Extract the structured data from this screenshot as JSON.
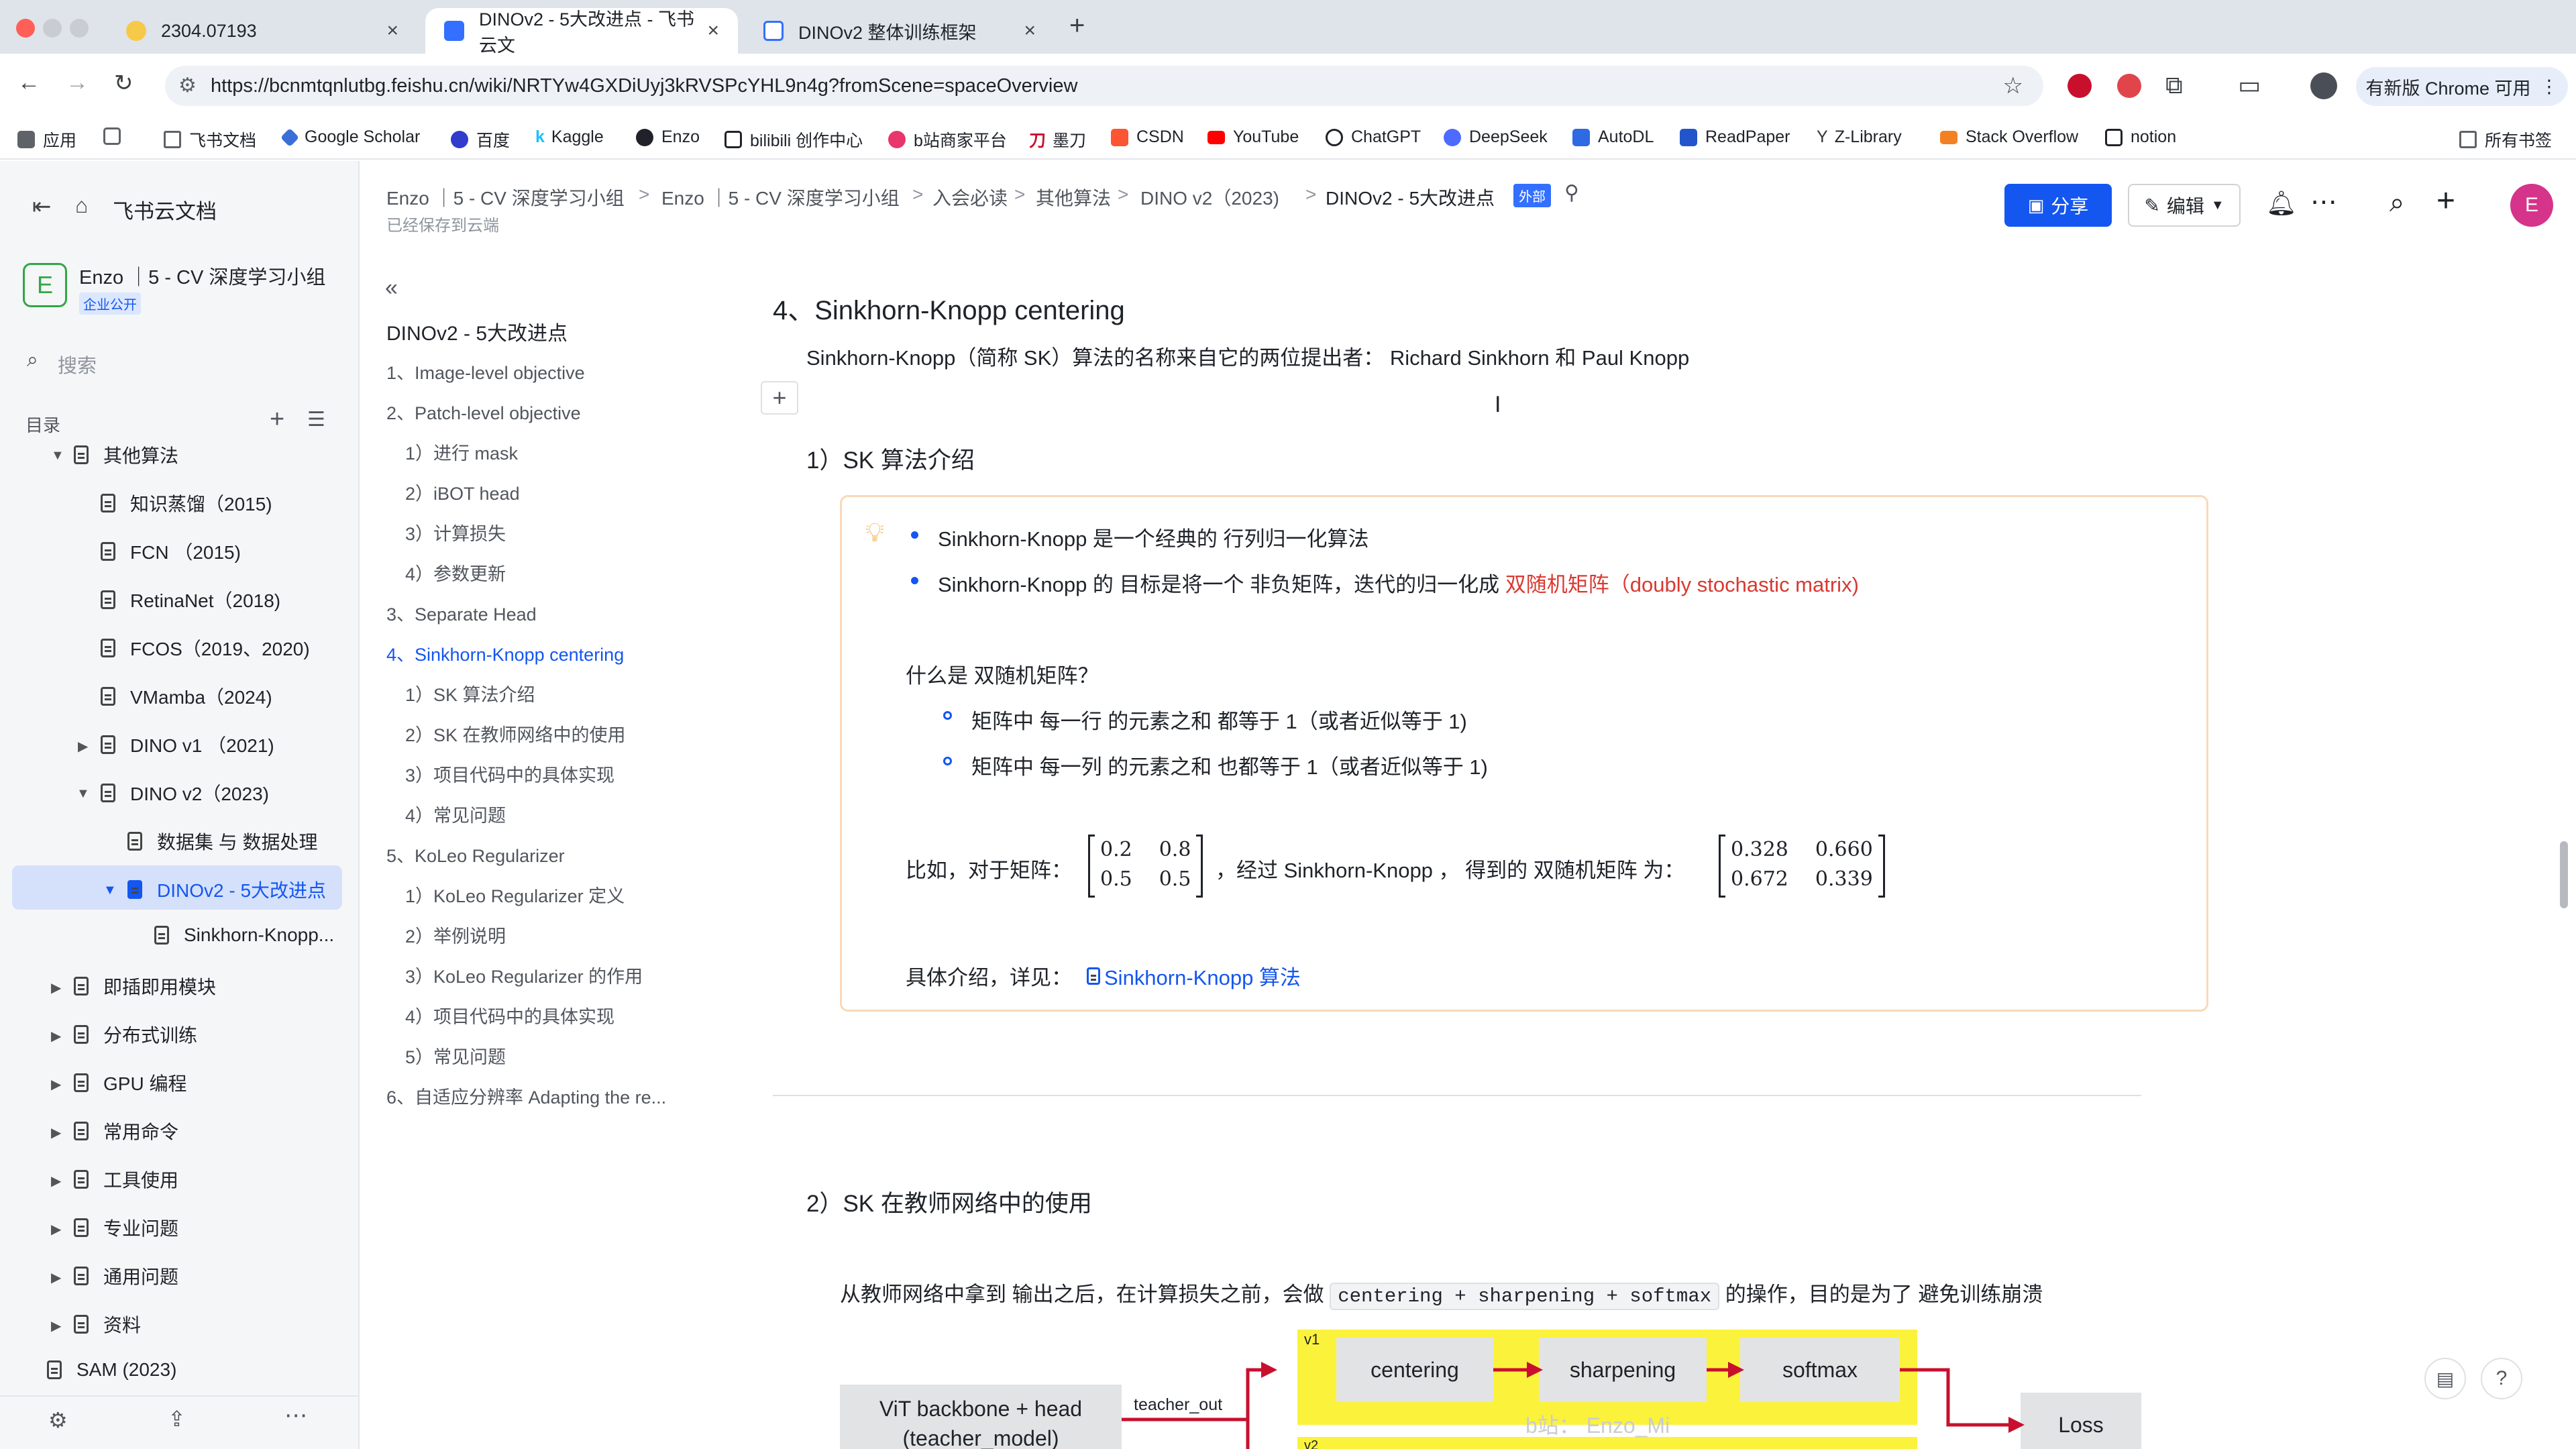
{
  "browser": {
    "tabs": [
      {
        "title": "2304.07193"
      },
      {
        "title": "DINOv2 - 5大改进点 - 飞书云文"
      },
      {
        "title": "DINOv2 整体训练框架"
      }
    ],
    "new_tab": "+",
    "url": "https://bcnmtqnlutbg.feishu.cn/wiki/NRTYw4GXDiUyj3kRVSPcYHL9n4g?fromScene=spaceOverview",
    "update_button": "有新版 Chrome 可用",
    "bookmarks": [
      "应用",
      "飞书文档",
      "Google Scholar",
      "百度",
      "Kaggle",
      "Enzo",
      "bilibili 创作中心",
      "b站商家平台",
      "墨刀",
      "CSDN",
      "YouTube",
      "ChatGPT",
      "DeepSeek",
      "AutoDL",
      "ReadPaper",
      "Z-Library",
      "Stack Overflow",
      "notion"
    ],
    "all_bookmarks": "所有书签"
  },
  "sidebar": {
    "app_title": "飞书云文档",
    "space_avatar": "E",
    "space_name": "Enzo ｜5 - CV 深度学习小组",
    "space_badge": "企业公开",
    "search_placeholder": "搜索",
    "toc_label": "目录",
    "items": [
      {
        "label": "其他算法"
      },
      {
        "label": "知识蒸馏（2015)"
      },
      {
        "label": "FCN （2015)"
      },
      {
        "label": "RetinaNet（2018)"
      },
      {
        "label": "FCOS（2019、2020)"
      },
      {
        "label": "VMamba（2024)"
      },
      {
        "label": "DINO v1 （2021)"
      },
      {
        "label": "DINO v2（2023)"
      },
      {
        "label": "数据集 与 数据处理"
      },
      {
        "label": "DINOv2 - 5大改进点"
      },
      {
        "label": "Sinkhorn-Knopp..."
      },
      {
        "label": "即插即用模块"
      },
      {
        "label": "分布式训练"
      },
      {
        "label": "GPU 编程"
      },
      {
        "label": "常用命令"
      },
      {
        "label": "工具使用"
      },
      {
        "label": "专业问题"
      },
      {
        "label": "通用问题"
      },
      {
        "label": "资料"
      },
      {
        "label": "SAM (2023)"
      }
    ]
  },
  "header": {
    "breadcrumbs": [
      "Enzo ｜5 - CV 深度学习小组",
      "Enzo ｜5 - CV 深度学习小组",
      "入会必读",
      "其他算法",
      "DINO v2（2023)",
      "DINOv2 - 5大改进点"
    ],
    "external_badge": "外部",
    "save_status": "已经保存到云端",
    "share_label": "分享",
    "edit_label": "编辑",
    "user_avatar": "E"
  },
  "outline": {
    "title": "DINOv2 - 5大改进点",
    "items": [
      "1、Image-level objective",
      "2、Patch-level objective",
      "1）进行 mask",
      "2）iBOT head",
      "3）计算损失",
      "4）参数更新",
      "3、Separate Head",
      "4、Sinkhorn-Knopp centering",
      "1）SK 算法介绍",
      "2）SK 在教师网络中的使用",
      "3）项目代码中的具体实现",
      "4）常见问题",
      "5、KoLeo Regularizer",
      "1）KoLeo Regularizer 定义",
      "2）举例说明",
      "3）KoLeo Regularizer 的作用",
      "4）项目代码中的具体实现",
      "5）常见问题",
      "6、自适应分辨率 Adapting the re..."
    ]
  },
  "content": {
    "section_title": "4、Sinkhorn-Knopp centering",
    "intro": "Sinkhorn-Knopp（简称 SK）算法的名称来自它的两位提出者： Richard Sinkhorn 和 Paul Knopp",
    "sub1_title": "1）SK 算法介绍",
    "callout": {
      "bullet1": "Sinkhorn-Knopp 是一个经典的 行列归一化算法",
      "bullet2_prefix": "Sinkhorn-Knopp 的 目标是将一个 非负矩阵，迭代的归一化成 ",
      "bullet2_highlight": "双随机矩阵（doubly stochastic matrix)",
      "question": "什么是 双随机矩阵？",
      "sub1": "矩阵中 每一行 的元素之和 都等于 1（或者近似等于 1)",
      "sub2": "矩阵中 每一列 的元素之和 也都等于 1（或者近似等于 1)",
      "example_prefix": "比如，对于矩阵：",
      "matrix_a": [
        [
          "0.2",
          "0.8"
        ],
        [
          "0.5",
          "0.5"
        ]
      ],
      "example_mid": "，经过 Sinkhorn-Knopp ， 得到的 双随机矩阵 为：",
      "matrix_b": [
        [
          "0.328",
          "0.660"
        ],
        [
          "0.672",
          "0.339"
        ]
      ],
      "detail_prefix": "具体介绍，详见：",
      "detail_link": "Sinkhorn-Knopp 算法"
    },
    "sub2_title": "2）SK 在教师网络中的使用",
    "para2_prefix": "从教师网络中拿到 输出之后，在计算损失之前，会做 ",
    "para2_code": "centering + sharpening + softmax",
    "para2_suffix": " 的操作，目的是为了 避免训练崩溃",
    "diagram": {
      "backbone_line1": "ViT backbone + head",
      "backbone_line2": "(teacher_model)",
      "edge_label": "teacher_out",
      "v1": "v1",
      "v2": "v2",
      "centering": "centering",
      "sharpening": "sharpening",
      "softmax": "softmax",
      "loss": "Loss",
      "watermark": "b站： Enzo_Mi"
    }
  },
  "colors": {
    "accent": "#1456f0",
    "highlight_red": "#d83931",
    "callout_border": "#f8d9b9",
    "diagram_yellow": "#fbf23c",
    "arrow_red": "#c8102e"
  }
}
